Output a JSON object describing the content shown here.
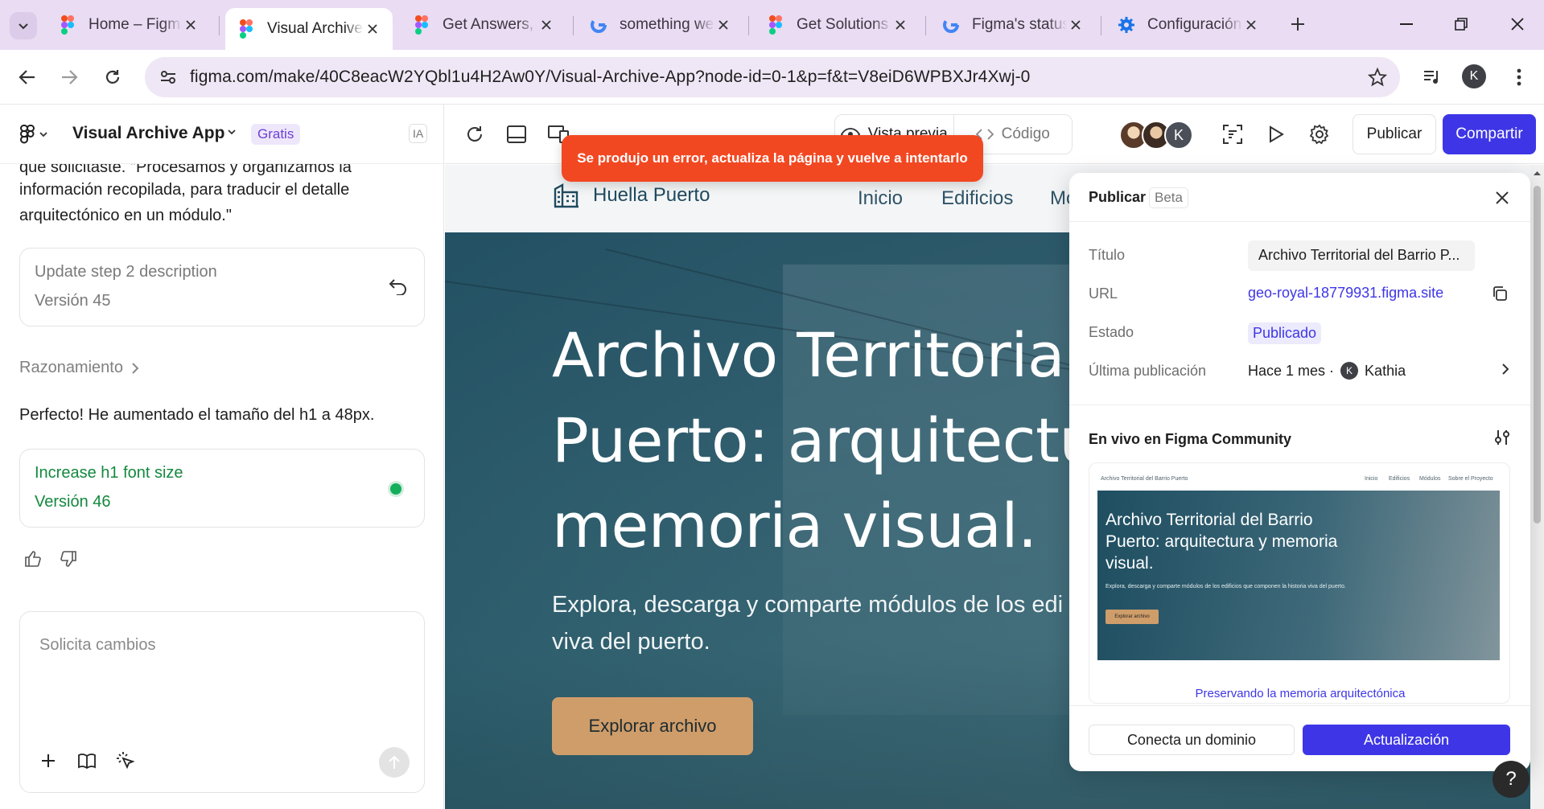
{
  "browser": {
    "tabs": [
      {
        "title": "Home – Figma",
        "favicon": "figma-icon",
        "active": false
      },
      {
        "title": "Visual Archive",
        "favicon": "figma-icon",
        "active": true
      },
      {
        "title": "Get Answers, S",
        "favicon": "figma-icon",
        "active": false
      },
      {
        "title": "something we",
        "favicon": "google-icon",
        "active": false
      },
      {
        "title": "Get Solutions",
        "favicon": "figma-icon",
        "active": false
      },
      {
        "title": "Figma's status",
        "favicon": "google-icon",
        "active": false
      },
      {
        "title": "Configuración",
        "favicon": "gear-icon",
        "active": false
      }
    ],
    "url": "figma.com/make/40C8eacW2YQbl1u4H2Aw0Y/Visual-Archive-App?node-id=0-1&p=f&t=V8eiD6WPBXJr4Xwj-0",
    "profile_initial": "K"
  },
  "app": {
    "file_title": "Visual Archive App",
    "plan_badge": "Gratis",
    "ai_badge": "IA"
  },
  "chat": {
    "prev_text": "que solicitaste. \"Procesamos y organizamos la información recopilada, para traducir el detalle arquitectónico en un módulo.\"",
    "prev_line1": "que solicitaste. \"Procesamos y organizamos la",
    "prev_line2": "información recopilada, para traducir el detalle",
    "prev_line3": "arquitectónico en un módulo.\"",
    "version_prev": {
      "title": "Update step 2 description",
      "version": "Versión 45"
    },
    "reasoning_label": "Razonamiento",
    "message": "Perfecto! He aumentado el tamaño del h1 a 48px.",
    "version_current": {
      "title": "Increase h1 font size",
      "version": "Versión 46"
    },
    "composer_placeholder": "Solicita cambios"
  },
  "toolbar": {
    "preview_label": "Vista previa",
    "code_label": "Código",
    "collaborator_initial": "K",
    "publish_label": "Publicar",
    "share_label": "Compartir"
  },
  "error_toast": "Se produjo un error, actualiza la página y vuelve a intentarlo",
  "site": {
    "brand": "Huella Puerto",
    "nav": [
      "Inicio",
      "Edificios",
      "Mó"
    ],
    "hero_line1": "Archivo Territorial",
    "hero_line2": "Puerto: arquitectu",
    "hero_line3": "memoria visual.",
    "sub_line1": "Explora, descarga y comparte módulos de los edi",
    "sub_line2": "viva del puerto.",
    "cta": "Explorar archivo"
  },
  "publish_panel": {
    "title": "Publicar",
    "beta": "Beta",
    "fields": {
      "title_label": "Título",
      "title_value": "Archivo Territorial del Barrio P...",
      "url_label": "URL",
      "url_value": "geo-royal-18779931.figma.site",
      "status_label": "Estado",
      "status_value": "Publicado",
      "last_label": "Última publicación",
      "last_value": "Hace 1 mes ·",
      "last_user_initial": "K",
      "last_user": "Kathia"
    },
    "community_label": "En vivo en Figma Community",
    "thumb": {
      "nav_brand": "Archivo Territorial del Barrio Puerto",
      "nav_links": [
        "Inicio",
        "Edificios",
        "Módulos",
        "Sobre el Proyecto"
      ],
      "h1": "Archivo Territorial del Barrio Puerto: arquitectura y memoria visual.",
      "sub": "Explora, descarga y comparte módulos de los edificios que componen la historia viva del puerto.",
      "cta": "Explorar archivo",
      "footer": "Preservando la memoria arquitectónica"
    },
    "connect_domain": "Conecta un dominio",
    "update": "Actualización"
  },
  "colors": {
    "accent": "#3e36e6",
    "error": "#f24822",
    "success": "#14883f",
    "hero_overlay": "#16485c",
    "cta": "#cf9d6a"
  }
}
